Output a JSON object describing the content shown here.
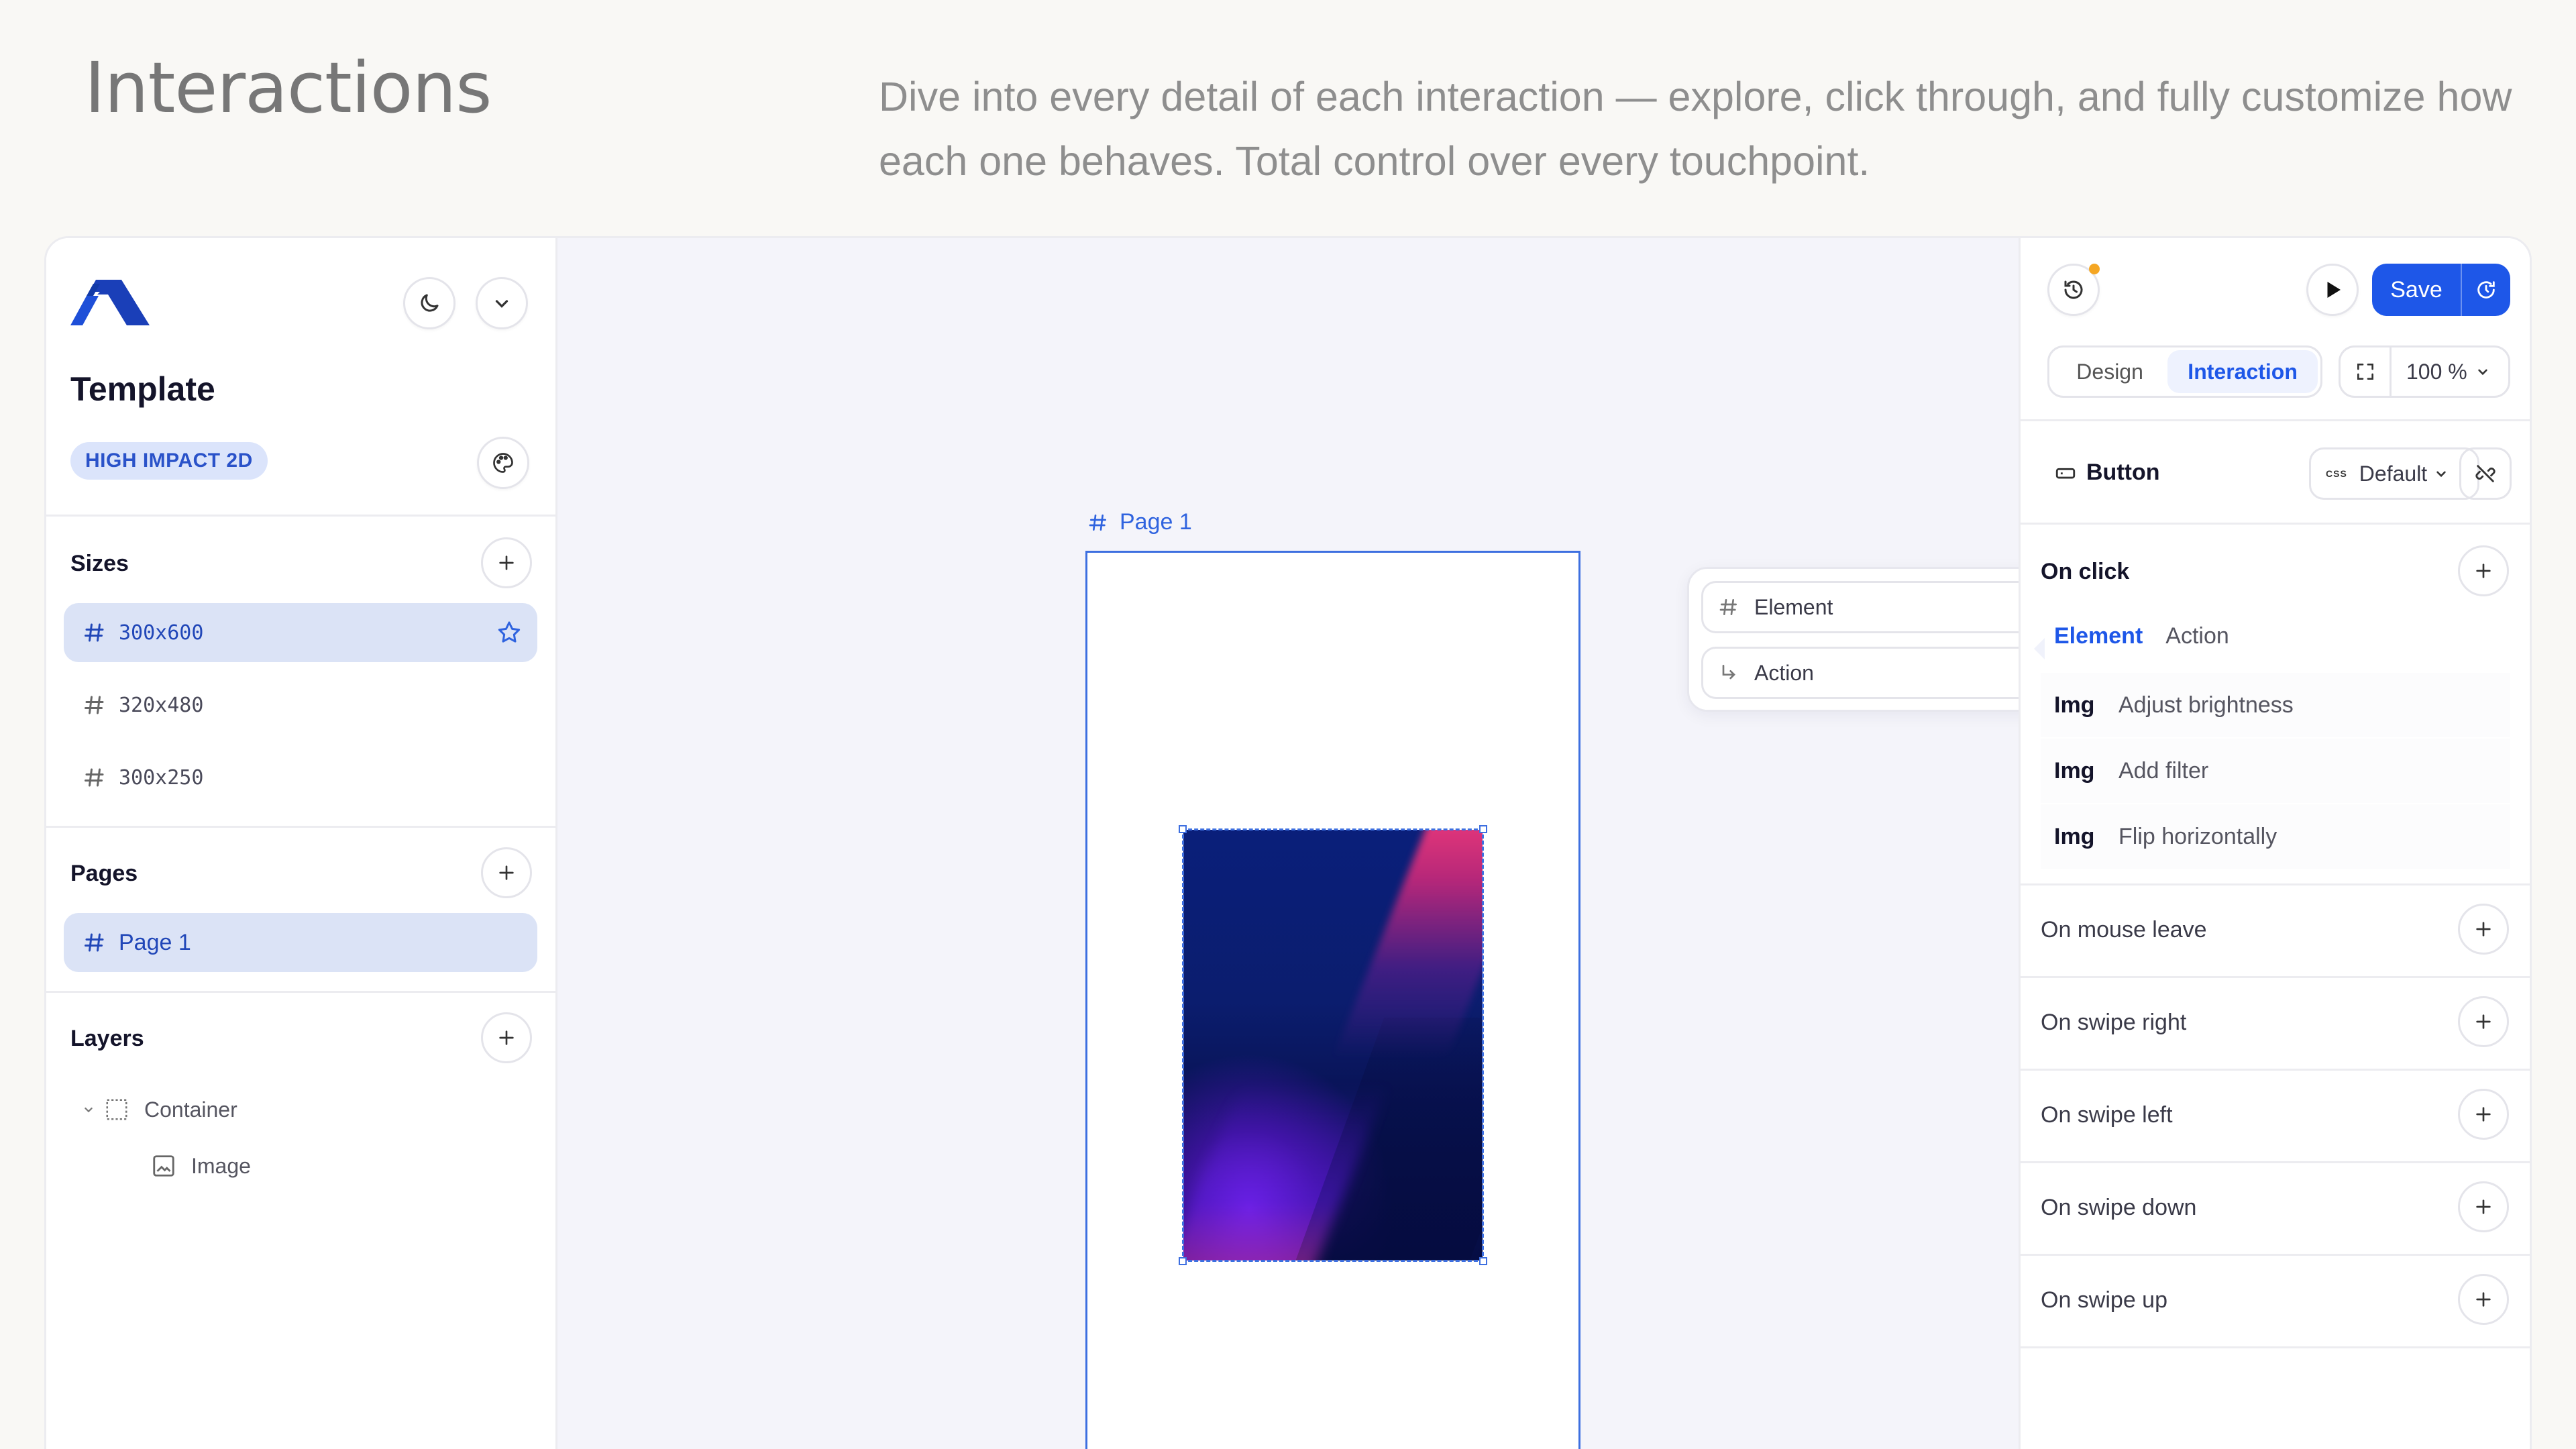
{
  "hero": {
    "title": "Interactions",
    "description": "Dive into every detail of each interaction — explore, click through, and fully customize how each one behaves. Total control over every touchpoint."
  },
  "sidebar": {
    "template_title": "Template",
    "badge": "HIGH IMPACT 2D",
    "sizes_label": "Sizes",
    "sizes": [
      {
        "label": "300x600",
        "active": true
      },
      {
        "label": "320x480",
        "active": false
      },
      {
        "label": "300x250",
        "active": false
      }
    ],
    "pages_label": "Pages",
    "pages": [
      {
        "label": "Page 1",
        "active": true
      }
    ],
    "layers_label": "Layers",
    "layers": [
      {
        "label": "Container",
        "icon": "container-icon"
      },
      {
        "label": "Image",
        "icon": "image-icon"
      }
    ]
  },
  "canvas": {
    "page_label": "Page 1",
    "popover": {
      "element_label": "Element",
      "action_label": "Action"
    }
  },
  "right_panel": {
    "save_label": "Save",
    "mode_tabs": [
      {
        "label": "Design",
        "active": false
      },
      {
        "label": "Interaction",
        "active": true
      }
    ],
    "zoom_value": "100 %",
    "selected_type": "Button",
    "state_select": "Default",
    "css_tag": "CSS",
    "on_click": {
      "label": "On click",
      "tabs": [
        {
          "label": "Element",
          "active": true
        },
        {
          "label": "Action",
          "active": false
        }
      ],
      "actions": [
        {
          "kind": "Img",
          "label": "Adjust brightness"
        },
        {
          "kind": "Img",
          "label": "Add filter"
        },
        {
          "kind": "Img",
          "label": "Flip horizontally"
        }
      ]
    },
    "events": [
      {
        "label": "On mouse leave"
      },
      {
        "label": "On swipe right"
      },
      {
        "label": "On swipe left"
      },
      {
        "label": "On swipe down"
      },
      {
        "label": "On swipe up"
      }
    ]
  },
  "colors": {
    "accent": "#1e57e8",
    "selected_row_bg": "#dbe3f6",
    "badge_bg": "#dbe4fb",
    "notification_dot": "#f5a623"
  }
}
